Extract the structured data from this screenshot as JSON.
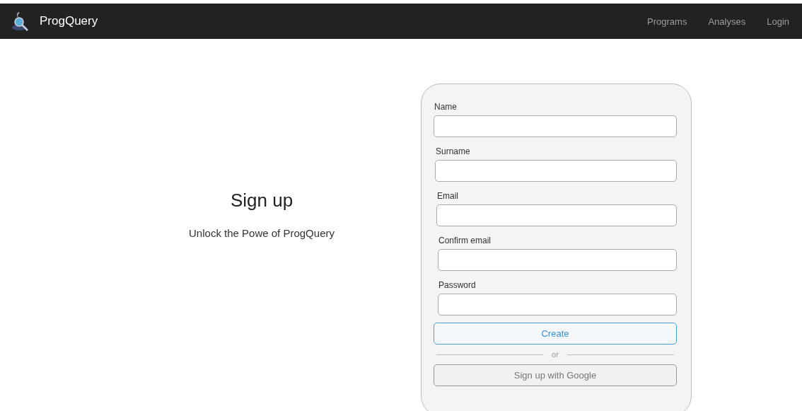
{
  "navbar": {
    "brand": "ProgQuery",
    "links": [
      "Programs",
      "Analyses",
      "Login"
    ]
  },
  "intro": {
    "title": "Sign up",
    "subtitle": "Unlock the Powe of ProgQuery"
  },
  "form": {
    "fields": [
      {
        "label": "Name"
      },
      {
        "label": "Surname"
      },
      {
        "label": "Email"
      },
      {
        "label": "Confirm email"
      },
      {
        "label": "Password"
      }
    ],
    "create_button": "Create",
    "divider": "or",
    "google_button": "Sign up with Google"
  }
}
